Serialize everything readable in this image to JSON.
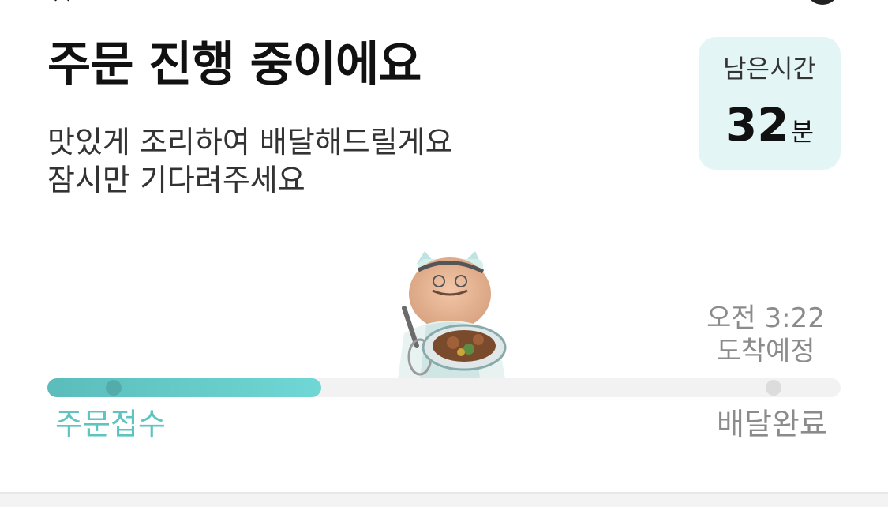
{
  "order_status": {
    "title": "주문 진행 중이에요",
    "subtitle_line1": "맛있게 조리하여 배달해드릴게요",
    "subtitle_line2": "잠시만 기다려주세요"
  },
  "remaining": {
    "label": "남은시간",
    "value": "32",
    "unit": "분"
  },
  "eta": {
    "time": "오전 3:22",
    "label": "도착예정"
  },
  "progress": {
    "fraction": 0.345,
    "start_label": "주문접수",
    "end_label": "배달완료"
  },
  "icons": {
    "mascot": "chef-mascot-illustration"
  },
  "colors": {
    "accent": "#5ec4c1",
    "time_box_bg": "#e3f5f4",
    "muted_text": "#8b8b8b"
  }
}
